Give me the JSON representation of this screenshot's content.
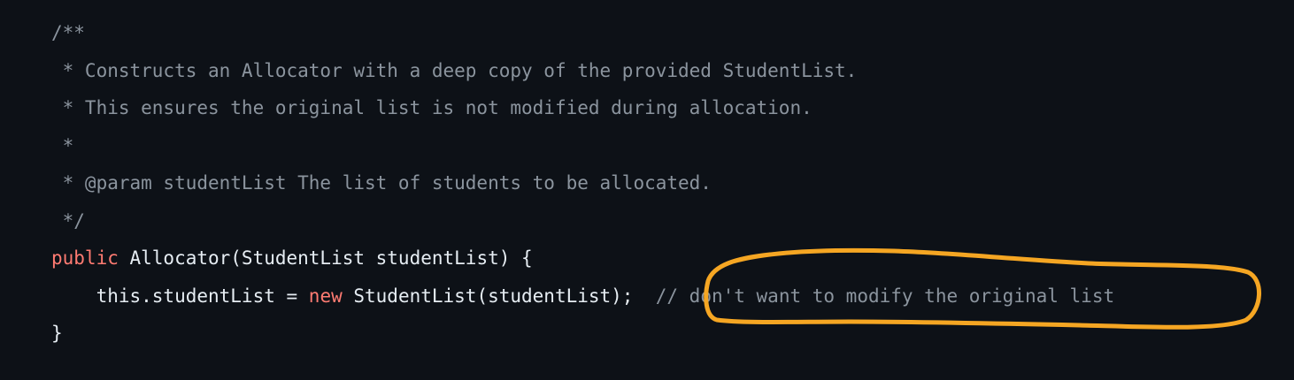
{
  "code": {
    "lines": [
      {
        "segments": [
          {
            "type": "comment",
            "text": "/**"
          }
        ]
      },
      {
        "segments": [
          {
            "type": "comment",
            "text": " * Constructs an Allocator with a deep copy of the provided StudentList."
          }
        ]
      },
      {
        "segments": [
          {
            "type": "comment",
            "text": " * This ensures the original list is not modified during allocation."
          }
        ]
      },
      {
        "segments": [
          {
            "type": "comment",
            "text": " *"
          }
        ]
      },
      {
        "segments": [
          {
            "type": "comment",
            "text": " * @param studentList The list of students to be allocated."
          }
        ]
      },
      {
        "segments": [
          {
            "type": "comment",
            "text": " */"
          }
        ]
      },
      {
        "segments": [
          {
            "type": "keyword",
            "text": "public"
          },
          {
            "type": "plain",
            "text": " Allocator(StudentList studentList) {"
          }
        ]
      },
      {
        "segments": [
          {
            "type": "plain",
            "text": "    this.studentList = "
          },
          {
            "type": "keyword",
            "text": "new"
          },
          {
            "type": "plain",
            "text": " StudentList(studentList);  "
          },
          {
            "type": "comment",
            "text": "// don't want to modify the original list"
          }
        ]
      },
      {
        "segments": [
          {
            "type": "plain",
            "text": "}"
          }
        ]
      }
    ]
  },
  "colors": {
    "background": "#0d1117",
    "plain_text": "#e6edf3",
    "comment": "#8b949e",
    "keyword": "#ff7b72",
    "annotation_highlight": "#f5a623"
  },
  "annotation": {
    "type": "hand-drawn-circle",
    "target": "// don't want to modify the original list"
  }
}
